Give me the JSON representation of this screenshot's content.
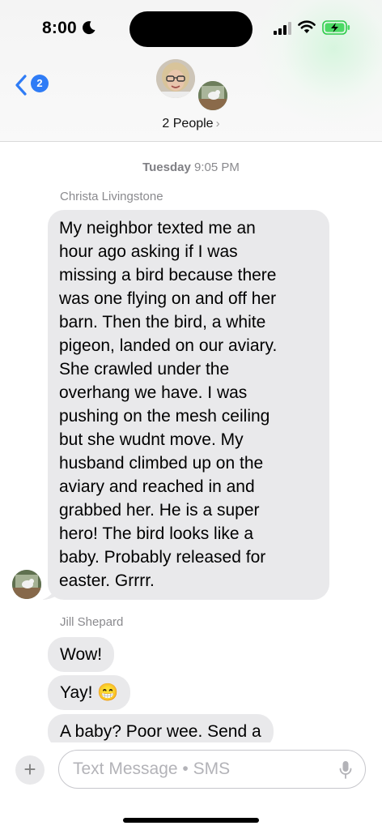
{
  "status_bar": {
    "time": "8:00",
    "battery_color": "#4cd964"
  },
  "header": {
    "back_badge": "2",
    "group_title": "2 People",
    "chevron": "›",
    "accent": "#2f7cf6"
  },
  "conversation": {
    "timestamp_day": "Tuesday",
    "timestamp_time": "9:05 PM",
    "messages": [
      {
        "sender": "Christa Livingstone",
        "lines": [
          "My neighbor texted me an",
          "hour ago asking if I was",
          "missing a bird because there",
          "was one flying on and off her",
          "barn. Then the bird, a white",
          "pigeon, landed on our aviary.",
          "She crawled under the",
          "overhang we have. I was",
          "pushing on the mesh ceiling",
          "but she wudnt move. My",
          "husband climbed up on the",
          "aviary and reached in and",
          "grabbed her. He is a super",
          "hero! The bird looks like a",
          "baby. Probably released for",
          "easter. Grrrr."
        ]
      },
      {
        "sender": "Jill Shepard",
        "bubbles": [
          "Wow!",
          "Yay! 😁",
          "A baby? Poor wee. Send a"
        ]
      }
    ],
    "bubble_color": "#e9e9eb"
  },
  "input": {
    "plus": "+",
    "placeholder": "Text Message • SMS"
  }
}
